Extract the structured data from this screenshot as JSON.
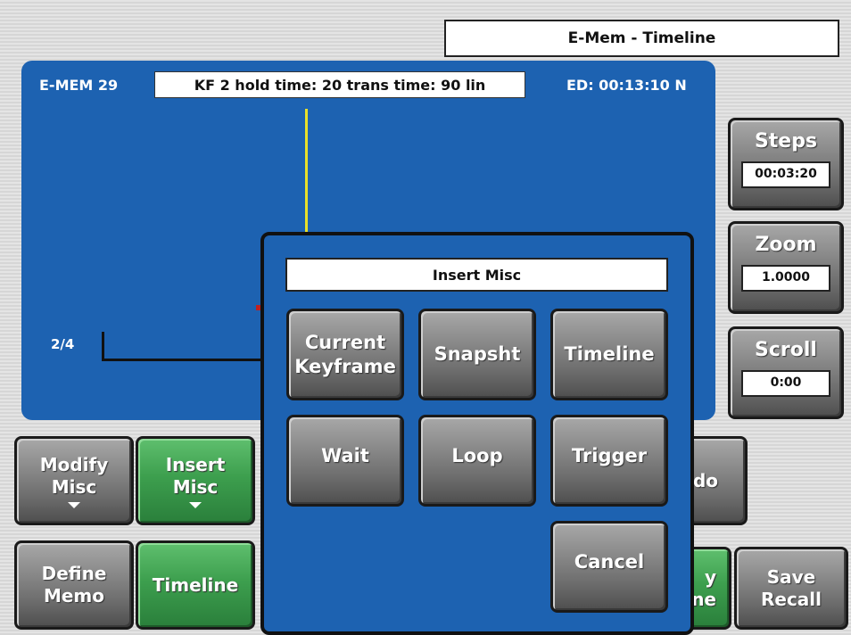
{
  "header": {
    "title": "E-Mem - Timeline"
  },
  "timeline": {
    "emem_label": "E-MEM 29",
    "keyframe_info": "KF 2 hold time: 20 trans time: 90 lin",
    "edit_duration": "ED: 00:13:10 N",
    "track_label": "2/4"
  },
  "params": [
    {
      "label": "Steps",
      "value": "00:03:20"
    },
    {
      "label": "Zoom",
      "value": "1.0000"
    },
    {
      "label": "Scroll",
      "value": "0:00"
    }
  ],
  "bottom_row1": [
    {
      "label_line1": "Modify",
      "label_line2": "Misc"
    },
    {
      "label_line1": "Insert",
      "label_line2": "Misc"
    },
    {
      "partial_label": "do"
    }
  ],
  "bottom_row2": [
    {
      "label_line1": "Define",
      "label_line2": "Memo"
    },
    {
      "label": "Timeline"
    },
    {
      "partial_line1": "y",
      "partial_line2": "ne"
    },
    {
      "label_line1": "Save",
      "label_line2": "Recall"
    }
  ],
  "modal": {
    "title": "Insert Misc",
    "buttons": {
      "current_line1": "Current",
      "current_line2": "Keyframe",
      "snapshot": "Snapsht",
      "timeline": "Timeline",
      "wait": "Wait",
      "loop": "Loop",
      "trigger": "Trigger",
      "cancel": "Cancel"
    }
  },
  "colors": {
    "panel_blue": "#1d62b1",
    "button_green": "#3d9f4e",
    "button_grey": "#8a8a8a",
    "cursor_yellow": "#e8e02a"
  }
}
